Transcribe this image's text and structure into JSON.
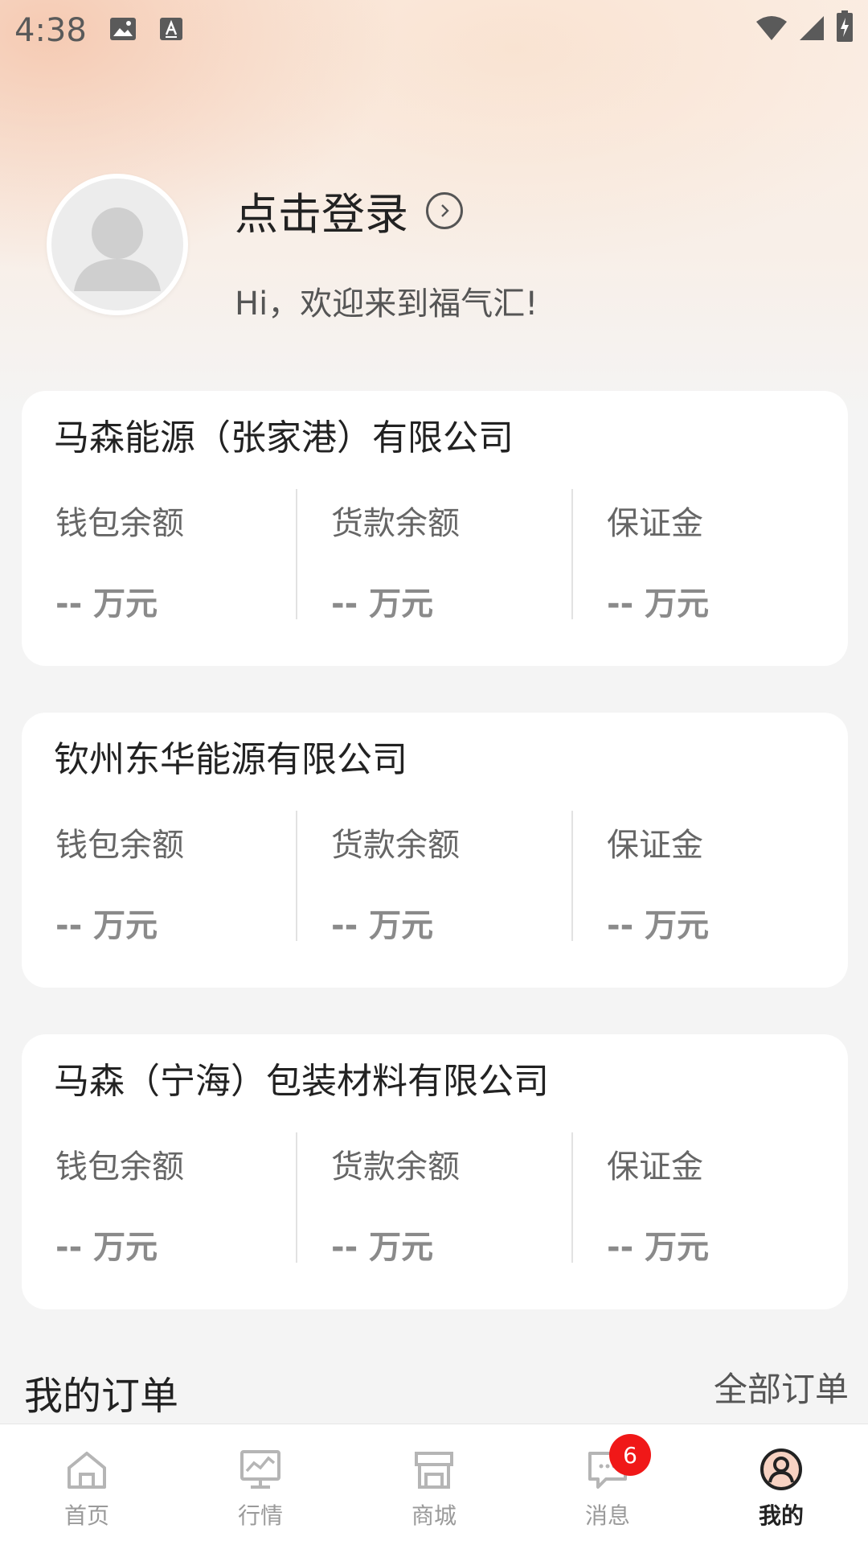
{
  "status_bar": {
    "time": "4:38"
  },
  "profile": {
    "login_text": "点击登录",
    "welcome_text": "Hi，欢迎来到福气汇!"
  },
  "metric_labels": [
    "钱包余额",
    "货款余额",
    "保证金"
  ],
  "companies": [
    {
      "name": "马森能源（张家港）有限公司",
      "wallet": "-- 万元",
      "payment": "-- 万元",
      "deposit": "-- 万元"
    },
    {
      "name": "钦州东华能源有限公司",
      "wallet": "-- 万元",
      "payment": "-- 万元",
      "deposit": "-- 万元"
    },
    {
      "name": "马森（宁海）包装材料有限公司",
      "wallet": "-- 万元",
      "payment": "-- 万元",
      "deposit": "-- 万元"
    }
  ],
  "orders": {
    "title": "我的订单",
    "all_link": "全部订单"
  },
  "tabbar": {
    "tabs": [
      {
        "label": "首页",
        "icon": "home-icon"
      },
      {
        "label": "行情",
        "icon": "market-chart-icon"
      },
      {
        "label": "商城",
        "icon": "store-icon"
      },
      {
        "label": "消息",
        "icon": "message-icon",
        "badge": "6"
      },
      {
        "label": "我的",
        "icon": "profile-icon",
        "active": true
      }
    ]
  },
  "colors": {
    "badge": "#f01818",
    "active_tab": "#222222",
    "inactive_tab": "#9a9a9a"
  }
}
